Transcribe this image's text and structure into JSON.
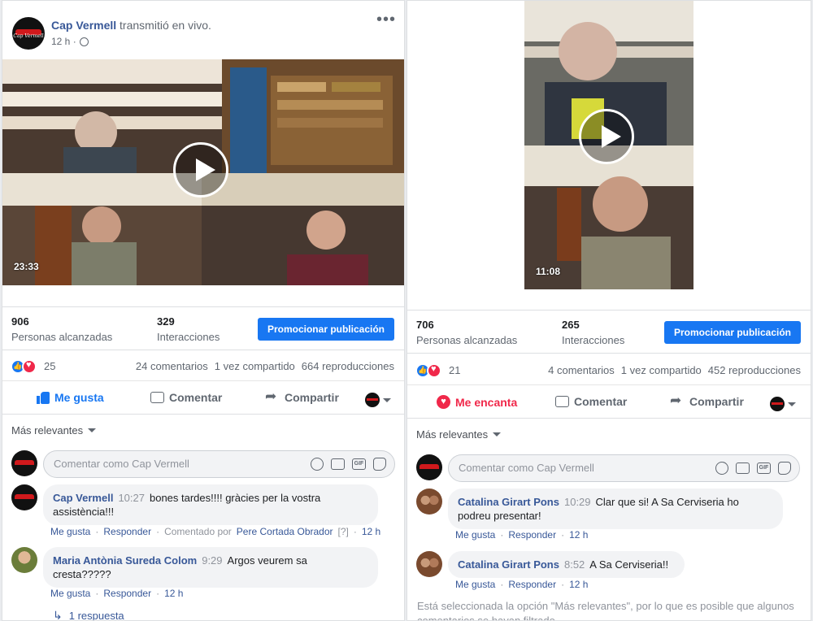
{
  "left": {
    "page_name": "Cap Vermell",
    "action_text": "transmitió en vivo.",
    "time": "12 h ·",
    "logo_text": "Cap Vermell",
    "video_duration": "23:33",
    "reach_num": "906",
    "reach_label": "Personas alcanzadas",
    "interactions_num": "329",
    "interactions_label": "Interacciones",
    "promote": "Promocionar publicación",
    "reaction_count": "25",
    "comments": "24 comentarios",
    "shares": "1 vez compartido",
    "views": "664 reproducciones",
    "like_label": "Me gusta",
    "comment_label": "Comentar",
    "share_label": "Compartir",
    "sort_label": "Más relevantes",
    "input_placeholder": "Comentar como Cap Vermell",
    "comment1": {
      "author": "Cap Vermell",
      "time": "10:27",
      "text_line1": "bones tardes!!!! gràcies per la vostra",
      "text_line2": "assistència!!!",
      "like": "Me gusta",
      "reply": "Responder",
      "commented_by": "Comentado por",
      "commenter": "Pere Cortada Obrador",
      "help": "[?]",
      "age": "12 h"
    },
    "comment2": {
      "author": "Maria Antònia Sureda Colom",
      "time": "9:29",
      "text_line1": "Argos veurem sa",
      "text_line2": "cresta?????",
      "like": "Me gusta",
      "reply": "Responder",
      "age": "12 h"
    },
    "replies": "1 respuesta"
  },
  "right": {
    "video_duration": "11:08",
    "reach_num": "706",
    "reach_label": "Personas alcanzadas",
    "interactions_num": "265",
    "interactions_label": "Interacciones",
    "promote": "Promocionar publicación",
    "reaction_count": "21",
    "comments": "4 comentarios",
    "shares": "1 vez compartido",
    "views": "452 reproducciones",
    "love_label": "Me encanta",
    "comment_label": "Comentar",
    "share_label": "Compartir",
    "sort_label": "Más relevantes",
    "input_placeholder": "Comentar como Cap Vermell",
    "comment1": {
      "author": "Catalina Girart Pons",
      "time": "10:29",
      "text_line1": "Clar que si! A Sa Cerviseria ho",
      "text_line2": "podreu presentar!",
      "like": "Me gusta",
      "reply": "Responder",
      "age": "12 h"
    },
    "comment2": {
      "author": "Catalina Girart Pons",
      "time": "8:52",
      "text": "A Sa Cerviseria!!",
      "like": "Me gusta",
      "reply": "Responder",
      "age": "12 h"
    },
    "filter_note": "Está seleccionada la opción \"Más relevantes\", por lo que es posible que algunos comentarios se hayan filtrado."
  },
  "colors": {
    "link": "#385898",
    "primary": "#1877f2",
    "love": "#f0284a",
    "brand_red": "#d0191c"
  }
}
